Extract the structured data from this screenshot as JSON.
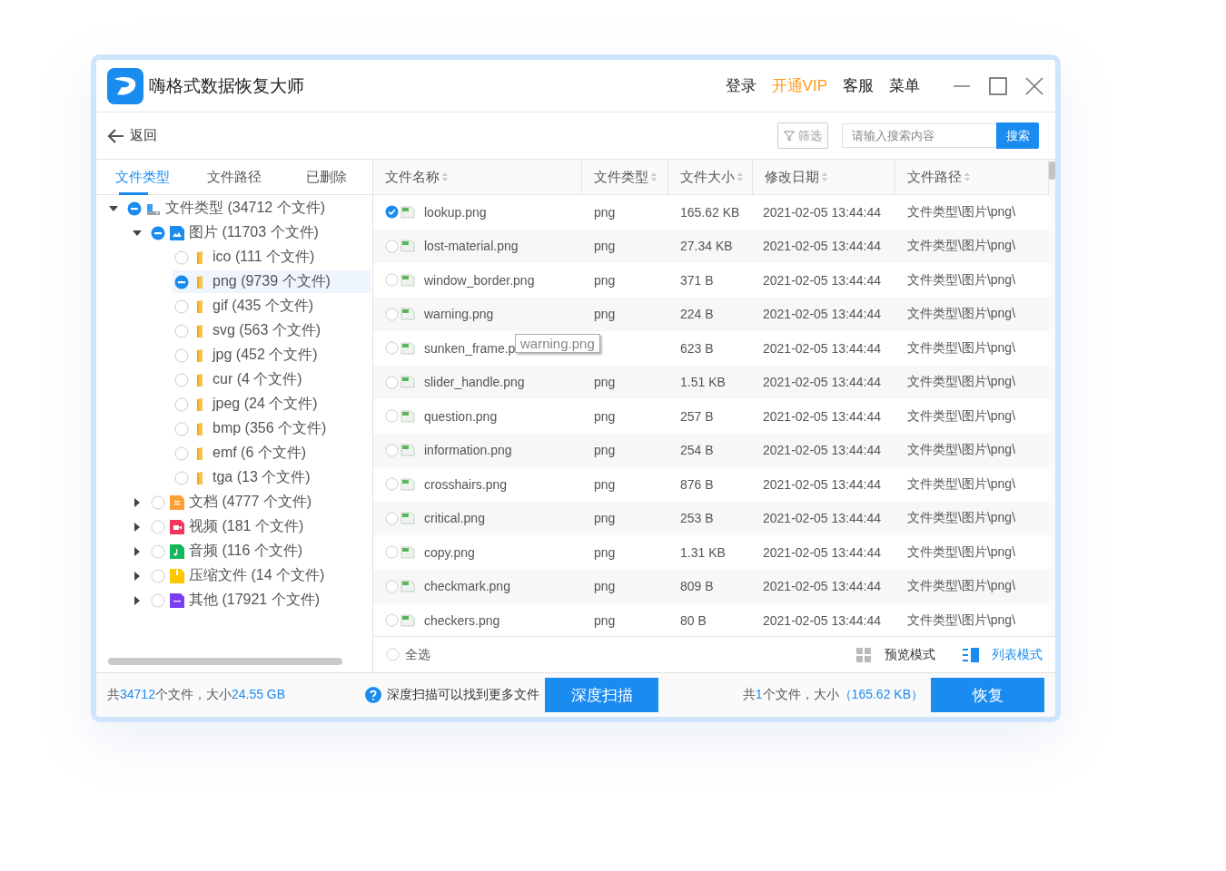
{
  "window": {
    "title": "嗨格式数据恢复大师"
  },
  "header_menu": [
    {
      "label": "登录",
      "kind": "plain"
    },
    {
      "label": "开通VIP",
      "kind": "vip"
    },
    {
      "label": "客服",
      "kind": "plain"
    },
    {
      "label": "菜单",
      "kind": "plain"
    }
  ],
  "toolbar": {
    "back": "返回",
    "filter": "筛选",
    "search": {
      "placeholder": "请输入搜索内容",
      "button": "搜索"
    }
  },
  "sidebar": {
    "tabs": [
      {
        "label": "文件类型",
        "selected": true
      },
      {
        "label": "文件路径",
        "selected": false
      },
      {
        "label": "已删除",
        "selected": false
      }
    ],
    "tree": [
      {
        "label": "文件类型 (34712 个文件)",
        "kind": "drive",
        "checked": false,
        "indeterminate": true,
        "expanded": true,
        "selected": false,
        "children": [
          {
            "label": "图片 (11703 个文件)",
            "kind": "image",
            "checked": false,
            "indeterminate": true,
            "expanded": true,
            "selected": false,
            "children": [
              {
                "label": "ico (111 个文件)",
                "kind": "folder",
                "checked": false,
                "indeterminate": false,
                "selected": false
              },
              {
                "label": "png (9739 个文件)",
                "kind": "folder",
                "checked": false,
                "indeterminate": true,
                "selected": true
              },
              {
                "label": "gif (435 个文件)",
                "kind": "folder",
                "checked": false,
                "indeterminate": false,
                "selected": false
              },
              {
                "label": "svg (563 个文件)",
                "kind": "folder",
                "checked": false,
                "indeterminate": false,
                "selected": false
              },
              {
                "label": "jpg (452 个文件)",
                "kind": "folder",
                "checked": false,
                "indeterminate": false,
                "selected": false
              },
              {
                "label": "cur (4 个文件)",
                "kind": "folder",
                "checked": false,
                "indeterminate": false,
                "selected": false
              },
              {
                "label": "jpeg (24 个文件)",
                "kind": "folder",
                "checked": false,
                "indeterminate": false,
                "selected": false
              },
              {
                "label": "bmp (356 个文件)",
                "kind": "folder",
                "checked": false,
                "indeterminate": false,
                "selected": false
              },
              {
                "label": "emf (6 个文件)",
                "kind": "folder",
                "checked": false,
                "indeterminate": false,
                "selected": false
              },
              {
                "label": "tga (13 个文件)",
                "kind": "folder",
                "checked": false,
                "indeterminate": false,
                "selected": false
              }
            ]
          },
          {
            "label": "文档 (4777 个文件)",
            "kind": "document",
            "checked": false,
            "indeterminate": false,
            "expanded": false,
            "selected": false
          },
          {
            "label": "视频 (181 个文件)",
            "kind": "video",
            "checked": false,
            "indeterminate": false,
            "expanded": false,
            "selected": false
          },
          {
            "label": "音频 (116 个文件)",
            "kind": "audio",
            "checked": false,
            "indeterminate": false,
            "expanded": false,
            "selected": false
          },
          {
            "label": "压缩文件 (14 个文件)",
            "kind": "archive",
            "checked": false,
            "indeterminate": false,
            "expanded": false,
            "selected": false
          },
          {
            "label": "其他 (17921 个文件)",
            "kind": "other",
            "checked": false,
            "indeterminate": false,
            "expanded": false,
            "selected": false
          }
        ]
      }
    ]
  },
  "table": {
    "columns": [
      "文件名称",
      "文件类型",
      "文件大小",
      "修改日期",
      "文件路径"
    ],
    "rows": [
      {
        "name": "lookup.png",
        "type": "png",
        "size": "165.62 KB",
        "modified": "2021-02-05 13:44:44",
        "path": "文件类型\\图片\\png\\",
        "checked": true
      },
      {
        "name": "lost-material.png",
        "type": "png",
        "size": "27.34 KB",
        "modified": "2021-02-05 13:44:44",
        "path": "文件类型\\图片\\png\\",
        "checked": false
      },
      {
        "name": "window_border.png",
        "type": "png",
        "size": "371 B",
        "modified": "2021-02-05 13:44:44",
        "path": "文件类型\\图片\\png\\",
        "checked": false
      },
      {
        "name": "warning.png",
        "type": "png",
        "size": "224 B",
        "modified": "2021-02-05 13:44:44",
        "path": "文件类型\\图片\\png\\",
        "checked": false
      },
      {
        "name": "sunken_frame.p",
        "size": "623 B",
        "modified": "2021-02-05 13:44:44",
        "path": "文件类型\\图片\\png\\",
        "checked": false
      },
      {
        "name": "slider_handle.png",
        "type": "png",
        "size": "1.51 KB",
        "modified": "2021-02-05 13:44:44",
        "path": "文件类型\\图片\\png\\",
        "checked": false
      },
      {
        "name": "question.png",
        "type": "png",
        "size": "257 B",
        "modified": "2021-02-05 13:44:44",
        "path": "文件类型\\图片\\png\\",
        "checked": false
      },
      {
        "name": "information.png",
        "type": "png",
        "size": "254 B",
        "modified": "2021-02-05 13:44:44",
        "path": "文件类型\\图片\\png\\",
        "checked": false
      },
      {
        "name": "crosshairs.png",
        "type": "png",
        "size": "876 B",
        "modified": "2021-02-05 13:44:44",
        "path": "文件类型\\图片\\png\\",
        "checked": false
      },
      {
        "name": "critical.png",
        "type": "png",
        "size": "253 B",
        "modified": "2021-02-05 13:44:44",
        "path": "文件类型\\图片\\png\\",
        "checked": false
      },
      {
        "name": "copy.png",
        "type": "png",
        "size": "1.31 KB",
        "modified": "2021-02-05 13:44:44",
        "path": "文件类型\\图片\\png\\",
        "checked": false
      },
      {
        "name": "checkmark.png",
        "type": "png",
        "size": "809 B",
        "modified": "2021-02-05 13:44:44",
        "path": "文件类型\\图片\\png\\",
        "checked": false
      },
      {
        "name": "checkers.png",
        "type": "png",
        "size": "80 B",
        "modified": "2021-02-05 13:44:44",
        "path": "文件类型\\图片\\png\\",
        "checked": false
      }
    ],
    "tooltip": "warning.png"
  },
  "table_footer": {
    "select_all": {
      "label": "全选",
      "checked": false
    },
    "views": [
      {
        "label": "预览模式",
        "kind": "grid",
        "selected": false
      },
      {
        "label": "列表模式",
        "kind": "list",
        "selected": true
      }
    ]
  },
  "footer": {
    "summary": [
      {
        "text": "共",
        "highlight": false
      },
      {
        "text": "34712",
        "highlight": true
      },
      {
        "text": "个文件，大小",
        "highlight": false
      },
      {
        "text": "24.55 GB",
        "highlight": true
      }
    ],
    "hint": "深度扫描可以找到更多文件",
    "scan_button": "深度扫描",
    "selection": [
      {
        "text": "共",
        "highlight": false
      },
      {
        "text": "1",
        "highlight": true
      },
      {
        "text": "个文件，大小",
        "highlight": false
      },
      {
        "text": "（165.62 KB）",
        "highlight": true
      }
    ],
    "recover_button": "恢复"
  }
}
